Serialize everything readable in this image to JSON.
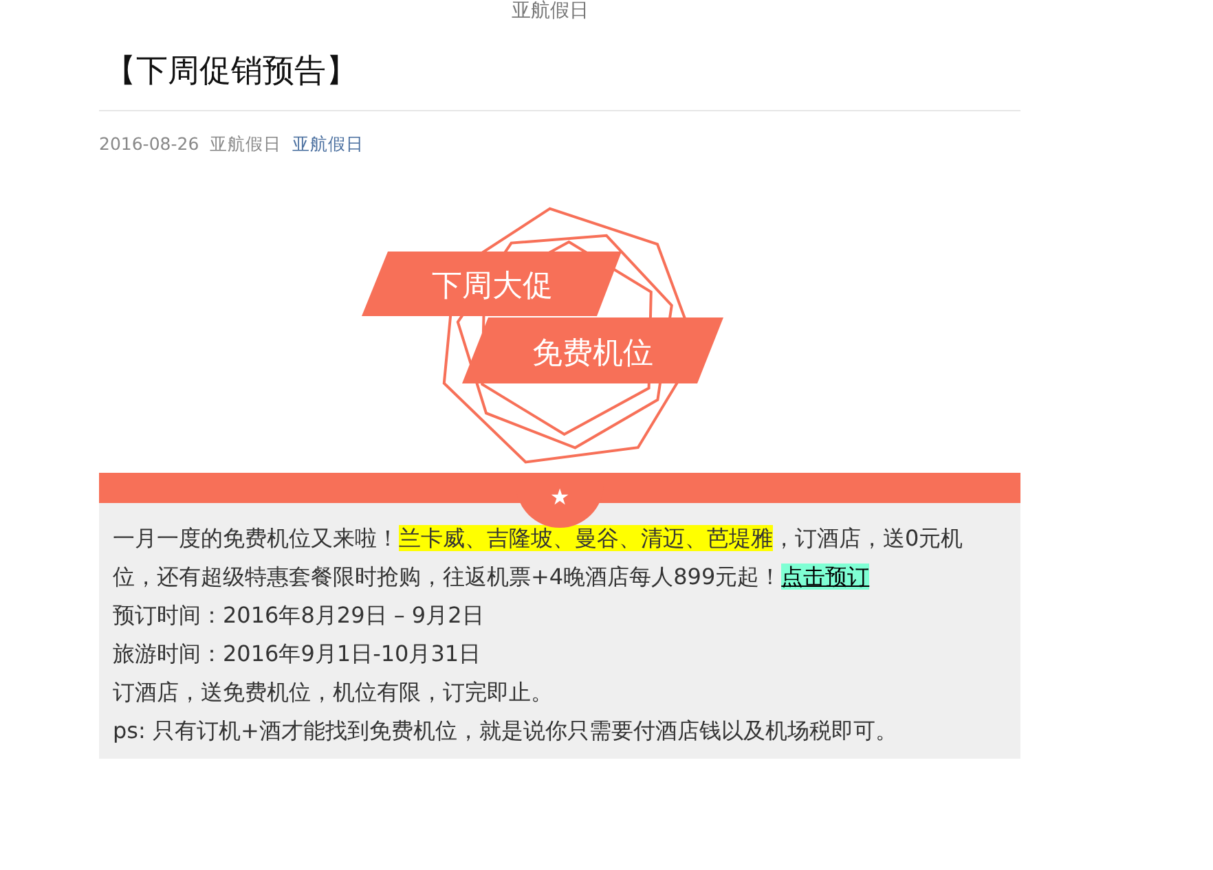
{
  "site_name": "亚航假日",
  "article": {
    "title": "【下周促销预告】",
    "date": "2016-08-26",
    "author": "亚航假日",
    "category": "亚航假日"
  },
  "banner": {
    "lines": [
      "下周大促",
      "免费机位"
    ],
    "divider_icon": "★"
  },
  "body": {
    "intro": [
      {
        "kind": "text",
        "text": "一月一度的免费机位又来啦！"
      },
      {
        "kind": "highlight",
        "text": "兰卡威、吉隆坡、曼谷、清迈、芭堤雅"
      },
      {
        "kind": "text",
        "text": "，订酒店，送0元机位，还有超级特惠套餐限时抢购，往返机票+4晚酒店每人899元起！"
      },
      {
        "kind": "link",
        "text": "点击预订"
      }
    ],
    "lines": [
      "预订时间：2016年8月29日 – 9月2日",
      "旅游时间：2016年9月1日-10月31日",
      "订酒店，送免费机位，机位有限，订完即止。",
      "ps: 只有订机+酒才能找到免费机位，就是说你只需要付酒店钱以及机场税即可。"
    ]
  }
}
